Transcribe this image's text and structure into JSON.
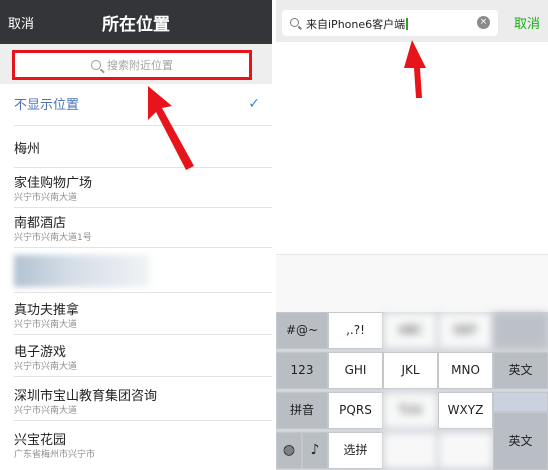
{
  "left_panel": {
    "nav": {
      "cancel_label": "取消",
      "title": "所在位置"
    },
    "search": {
      "placeholder": "搜索附近位置"
    },
    "rows": [
      {
        "name": "不显示位置",
        "selected": true
      },
      {
        "name": "梅州"
      },
      {
        "name": "家佳购物广场",
        "address": "兴宁市兴南大道"
      },
      {
        "name": "南都酒店",
        "address": "兴宁市兴南大道1号"
      },
      {
        "name": "",
        "address": ""
      },
      {
        "name": "真功夫推拿",
        "address": "兴宁市兴南大道"
      },
      {
        "name": "电子游戏",
        "address": "兴宁市兴南大道"
      },
      {
        "name": "深圳市宝山教育集团咨询",
        "address": "兴宁市兴南大道"
      },
      {
        "name": "兴宝花园",
        "address": "广东省梅州市兴宁市"
      }
    ]
  },
  "right_panel": {
    "search": {
      "text": "来自iPhone6客户端",
      "clear_icon": "clear-icon"
    },
    "cancel_label": "取消",
    "keyboard": {
      "row1": [
        "#@~",
        ",.?!",
        "ABC",
        "DEF",
        ""
      ],
      "row2": [
        "123",
        "GHI",
        "JKL",
        "MNO",
        "英文"
      ],
      "row3": [
        "拼音",
        "PQRS",
        "TUV",
        "WXYZ",
        ""
      ],
      "row4": [
        "globe-icon",
        "mic-icon",
        "选拼",
        "",
        "",
        "英文"
      ]
    }
  },
  "colors": {
    "highlight_red": "#e8141b",
    "accent_green": "#1aac19",
    "nav_dark": "#333538"
  }
}
